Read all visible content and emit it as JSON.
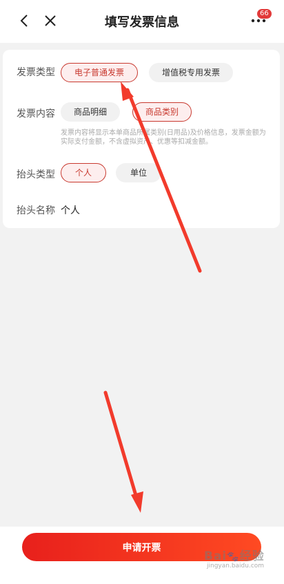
{
  "header": {
    "title": "填写发票信息",
    "badge_count": "66",
    "icons": {
      "back": "chevron-left-icon",
      "close": "close-icon",
      "more": "more-dots-icon"
    }
  },
  "form": {
    "invoice_type": {
      "label": "发票类型",
      "options": [
        {
          "label": "电子普通发票",
          "selected": true
        },
        {
          "label": "增值税专用发票",
          "selected": false
        }
      ]
    },
    "invoice_content": {
      "label": "发票内容",
      "options": [
        {
          "label": "商品明细",
          "selected": false
        },
        {
          "label": "商品类别",
          "selected": true
        }
      ],
      "note": "发票内容将显示本单商品所属类别(日用品)及价格信息，发票金额为实际支付金额，不含虚拟资产、优惠等扣减金额。"
    },
    "title_type": {
      "label": "抬头类型",
      "options": [
        {
          "label": "个人",
          "selected": true
        },
        {
          "label": "单位",
          "selected": false
        }
      ]
    },
    "title_name": {
      "label": "抬头名称",
      "value": "个人"
    }
  },
  "footer": {
    "apply_label": "申请开票"
  },
  "colors": {
    "accent": "#c8392f",
    "button_start": "#e8201c",
    "button_end": "#ff4a22",
    "background": "#f2f2f2"
  },
  "watermark": {
    "logo": "Bai 经验",
    "url": "jingyan.baidu.com"
  }
}
